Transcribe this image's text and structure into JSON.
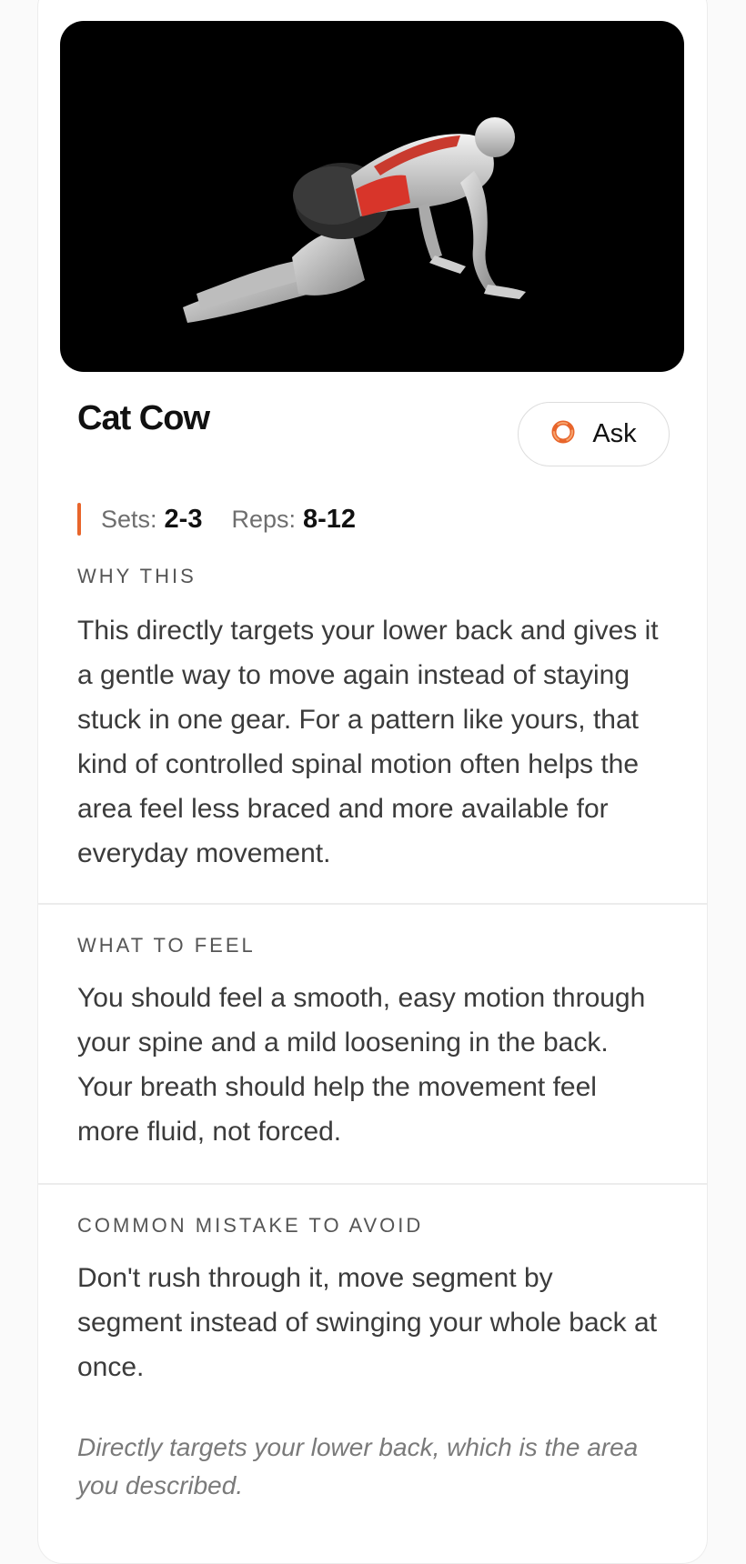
{
  "exercise": {
    "title": "Cat Cow",
    "ask_label": "Ask",
    "sets_label": "Sets:",
    "sets_value": "2-3",
    "reps_label": "Reps:",
    "reps_value": "8-12"
  },
  "sections": [
    {
      "label": "WHY THIS",
      "body": "This directly targets your lower back and gives it a gentle way to move again instead of staying stuck in one gear. For a pattern like yours, that kind of controlled spinal motion often helps the area feel less braced and more available for everyday movement."
    },
    {
      "label": "WHAT TO FEEL",
      "body": "You should feel a smooth, easy motion through your spine and a mild loosening in the back. Your breath should help the movement feel more fluid, not forced."
    },
    {
      "label": "COMMON MISTAKE TO AVOID",
      "body": "Don't rush through it, move segment by segment instead of swinging your whole back at once."
    }
  ],
  "footnote": "Directly targets your lower back, which is the area you described.",
  "colors": {
    "accent": "#e8652b",
    "muscle_highlight": "#d8352a",
    "media_background": "#000000"
  },
  "icons": {
    "ask": "ask-orb-icon"
  }
}
